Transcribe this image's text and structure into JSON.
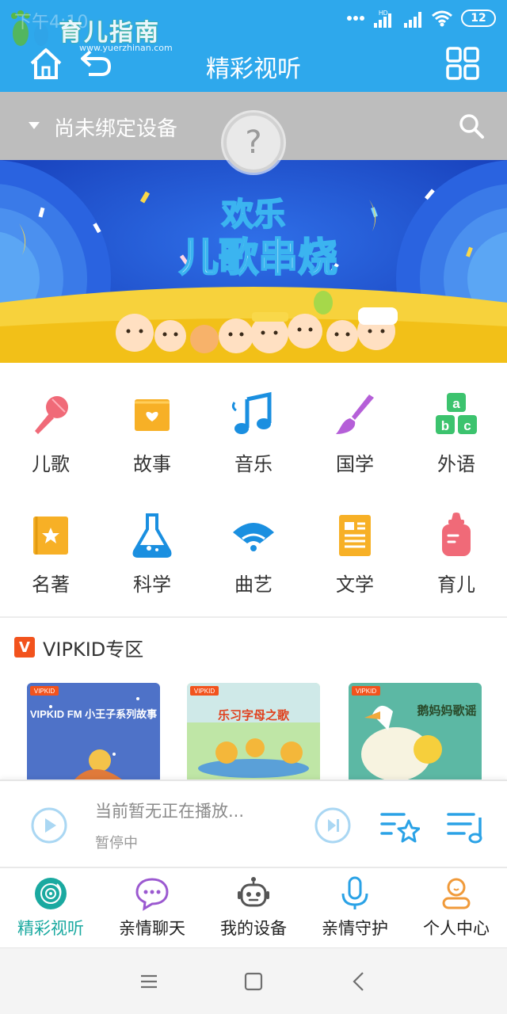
{
  "status_bar": {
    "time": "下午4:10",
    "watermark_text": "育儿指南",
    "watermark_url": "www.yuerzhinan.com",
    "network": "HD",
    "battery": "12"
  },
  "header": {
    "title": "精彩视听",
    "home_icon": "home-icon",
    "back_icon": "back-arrow-icon",
    "menu_icon": "grid-menu-icon"
  },
  "device_bar": {
    "label": "尚未绑定设备",
    "help_symbol": "?",
    "search_icon": "search-icon"
  },
  "banner": {
    "line1": "欢乐",
    "line2": "儿歌串烧"
  },
  "categories": [
    {
      "label": "儿歌",
      "icon": "microphone-icon",
      "color": "#f06a78"
    },
    {
      "label": "故事",
      "icon": "story-book-icon",
      "color": "#f7b026"
    },
    {
      "label": "音乐",
      "icon": "music-note-icon",
      "color": "#1a8fe0"
    },
    {
      "label": "国学",
      "icon": "brush-icon",
      "color": "#b55fd8"
    },
    {
      "label": "外语",
      "icon": "abc-blocks-icon",
      "color": "#3cc36e"
    },
    {
      "label": "名著",
      "icon": "classic-book-icon",
      "color": "#f7b026"
    },
    {
      "label": "科学",
      "icon": "flask-icon",
      "color": "#1a8fe0"
    },
    {
      "label": "曲艺",
      "icon": "fan-icon",
      "color": "#1a8fe0"
    },
    {
      "label": "文学",
      "icon": "document-icon",
      "color": "#f7b026"
    },
    {
      "label": "育儿",
      "icon": "baby-bottle-icon",
      "color": "#f06a78"
    }
  ],
  "vip_section": {
    "logo": "V",
    "title": "VIPKID专区",
    "cards": [
      {
        "title": "VIPKID FM 小王子系列故事",
        "badge": "VIPKID"
      },
      {
        "title": "乐习字母之歌",
        "badge": "VIPKID"
      },
      {
        "title": "鹅妈妈歌谣",
        "badge": "VIPKID"
      }
    ]
  },
  "player": {
    "now_playing": "当前暂无正在播放...",
    "state": "暂停中"
  },
  "tabs": [
    {
      "label": "精彩视听",
      "icon": "audio-disc-icon",
      "active": true
    },
    {
      "label": "亲情聊天",
      "icon": "chat-bubble-icon",
      "active": false
    },
    {
      "label": "我的设备",
      "icon": "robot-icon",
      "active": false
    },
    {
      "label": "亲情守护",
      "icon": "microphone-outline-icon",
      "active": false
    },
    {
      "label": "个人中心",
      "icon": "user-icon",
      "active": false
    }
  ],
  "colors": {
    "header_blue": "#2ea8ec",
    "device_bar_gray": "#bdbdbd",
    "active_tab_teal": "#1aa9a0",
    "player_accent": "#2aa2e6"
  }
}
